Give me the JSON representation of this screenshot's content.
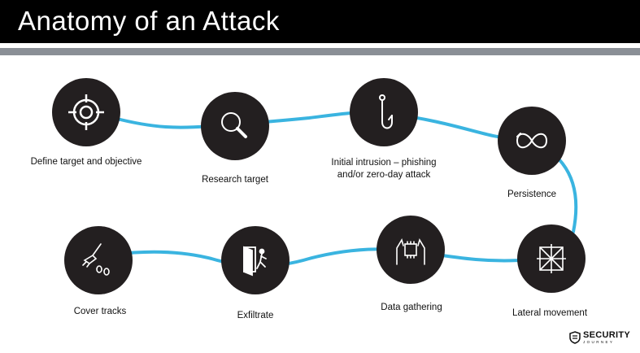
{
  "title": "Anatomy of an Attack",
  "steps": [
    {
      "label": "Define target and objective",
      "icon": "crosshair-icon"
    },
    {
      "label": "Research target",
      "icon": "magnifier-icon"
    },
    {
      "label": "Initial intrusion – phishing\nand/or zero-day attack",
      "icon": "fishhook-icon"
    },
    {
      "label": "Persistence",
      "icon": "infinity-loop-icon"
    },
    {
      "label": "Lateral movement",
      "icon": "expand-arrows-icon"
    },
    {
      "label": "Data gathering",
      "icon": "hands-chip-icon"
    },
    {
      "label": "Exfiltrate",
      "icon": "exit-door-icon"
    },
    {
      "label": "Cover tracks",
      "icon": "broom-footprints-icon"
    }
  ],
  "brand": {
    "name": "SECURITY",
    "sub": "JOURNEY"
  },
  "colors": {
    "circle": "#231f20",
    "path": "#3ab4e0",
    "titlebar": "#000000",
    "accentbar": "#8a8f96"
  }
}
